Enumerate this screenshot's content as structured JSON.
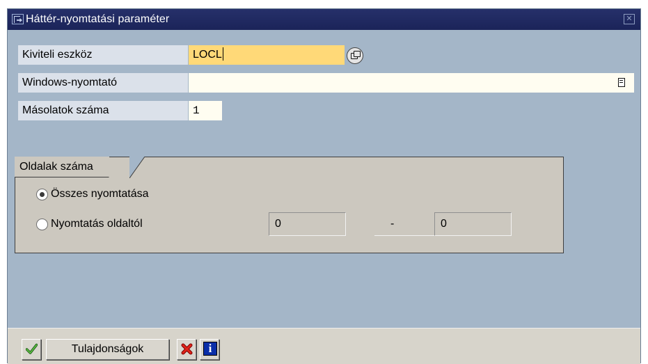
{
  "window": {
    "title": "Háttér-nyomtatási paraméter",
    "close_symbol": "✕"
  },
  "form": {
    "output_device_label": "Kiviteli eszköz",
    "output_device_value": "LOCL",
    "windows_printer_label": "Windows-nyomtató",
    "windows_printer_value": "",
    "copies_label": "Másolatok száma",
    "copies_value": "1"
  },
  "pages_group": {
    "title": "Oldalak száma",
    "print_all_label": "Összes nyomtatása",
    "print_all_selected": true,
    "print_from_label": "Nyomtatás oldaltól",
    "print_from_selected": false,
    "from_page": "0",
    "range_separator": "-",
    "to_page": "0"
  },
  "toolbar": {
    "confirm_icon": "checkmark-icon",
    "properties_label": "Tulajdonságok",
    "cancel_icon": "cancel-x-icon",
    "info_icon": "info-icon",
    "info_glyph": "i"
  },
  "colors": {
    "title_bar": "#1b2459",
    "window_bg": "#a4b6c8",
    "required_field": "#ffd978",
    "group_bg": "#ccc8bf",
    "footer_bg": "#d7d4cb"
  }
}
